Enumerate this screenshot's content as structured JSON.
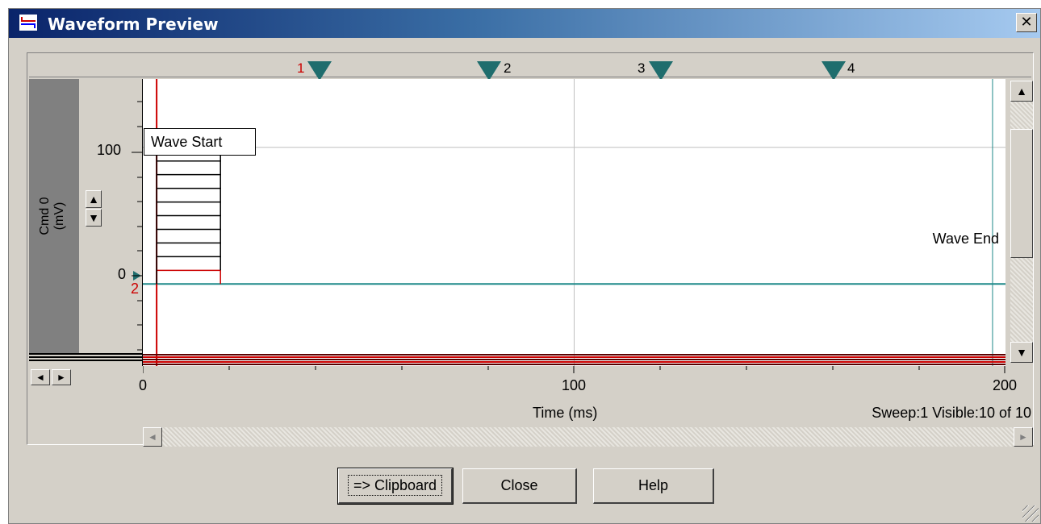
{
  "window": {
    "title": "Waveform Preview",
    "close_label": "✕"
  },
  "epochs": [
    "1",
    "2",
    "3",
    "4"
  ],
  "yaxis": {
    "label": "Cmd 0\n(mV)",
    "ticks": [
      "100",
      "0"
    ],
    "marker_below_zero": "2",
    "spin_up": "▲",
    "spin_down": "▼"
  },
  "plot": {
    "wave_start_label": "Wave Start",
    "wave_end_label": "Wave End"
  },
  "xaxis": {
    "ticks": [
      "0",
      "100",
      "200"
    ],
    "label": "Time (ms)"
  },
  "status": "Sweep:1 Visible:10 of 10",
  "hscroll": {
    "left": "◄",
    "right": "►"
  },
  "vscroll": {
    "up": "▲",
    "down": "▼"
  },
  "pan": {
    "left": "◄",
    "right": "►"
  },
  "buttons": {
    "clipboard": "=> Clipboard",
    "close": "Close",
    "help": "Help"
  },
  "colors": {
    "trace": "#cc0000",
    "baseline": "#1f8a8a",
    "marker": "#1f6d6d",
    "grid": "#c0c0c0"
  },
  "chart_data": {
    "type": "line",
    "xlabel": "Time (ms)",
    "ylabel": "Cmd 0 (mV)",
    "xlim": [
      0,
      200
    ],
    "ylim": [
      -60,
      150
    ],
    "holding_level": 0,
    "epoch_start_ms": 3.2,
    "epoch_end_ms": 18.0,
    "wave_end_ms": 197.0,
    "series": [
      {
        "values": [
          10
        ]
      },
      {
        "values": [
          20
        ]
      },
      {
        "values": [
          30
        ]
      },
      {
        "values": [
          40
        ]
      },
      {
        "values": [
          50
        ]
      },
      {
        "values": [
          60
        ]
      },
      {
        "values": [
          70
        ]
      },
      {
        "values": [
          80
        ]
      },
      {
        "values": [
          90
        ]
      },
      {
        "values": [
          100
        ]
      }
    ]
  }
}
